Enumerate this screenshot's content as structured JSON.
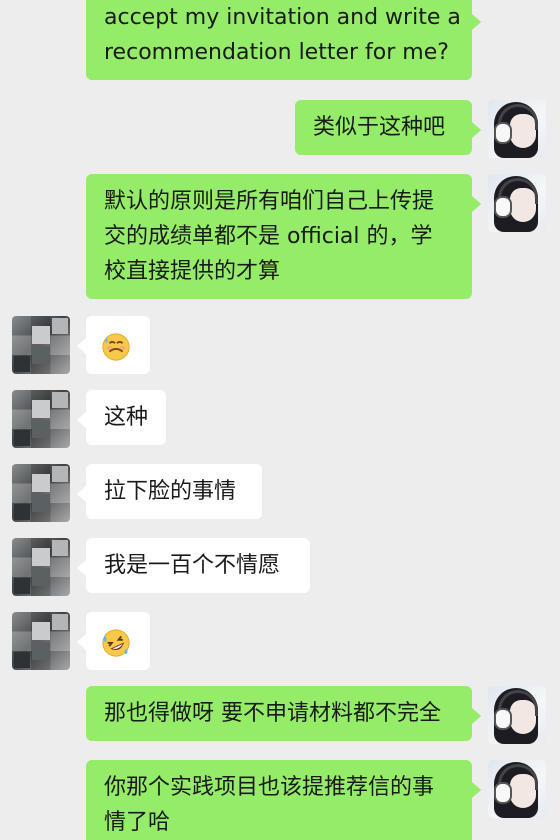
{
  "messages": [
    {
      "sender": "self",
      "lines": [
        "accept my invitation and write a",
        "recommendation letter for me?"
      ]
    },
    {
      "sender": "self",
      "lines": [
        "类似于这种吧"
      ]
    },
    {
      "sender": "self",
      "lines": [
        "默认的原则是所有咱们自己上传提",
        "交的成绩单都不是 official 的，学",
        "校直接提供的才算"
      ]
    },
    {
      "sender": "other",
      "emoji": "upside-down-sweat-face-icon"
    },
    {
      "sender": "other",
      "lines": [
        "这种"
      ]
    },
    {
      "sender": "other",
      "lines": [
        "拉下脸的事情"
      ]
    },
    {
      "sender": "other",
      "lines": [
        "我是一百个不情愿"
      ]
    },
    {
      "sender": "other",
      "emoji": "rolling-laughing-face-icon"
    },
    {
      "sender": "self",
      "lines": [
        "那也得做呀 要不申请材料都不完全"
      ]
    },
    {
      "sender": "self",
      "lines": [
        "你那个实践项目也该提推荐信的事",
        "情了哈"
      ]
    }
  ],
  "colors": {
    "background": "#ededed",
    "outgoing_bubble": "#95ec69",
    "incoming_bubble": "#ffffff",
    "text": "#1a1a1a"
  }
}
